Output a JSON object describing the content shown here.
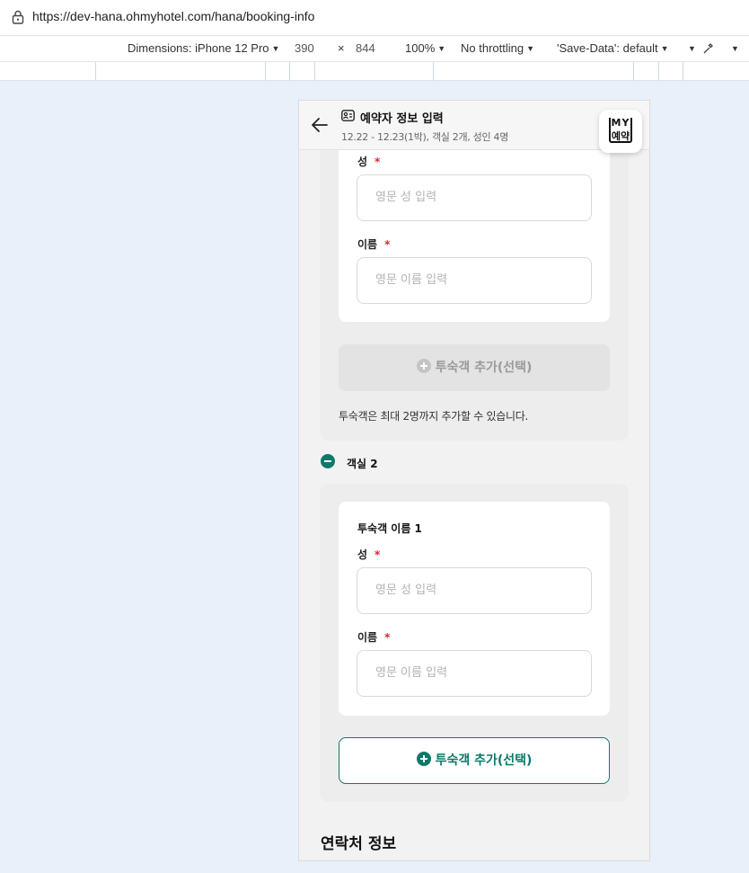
{
  "browser": {
    "url": "https://dev-hana.ohmyhotel.com/hana/booking-info"
  },
  "device_toolbar": {
    "dimensions_label": "Dimensions: iPhone 12 Pro",
    "width": "390",
    "times": "×",
    "height": "844",
    "zoom": "100%",
    "throttling": "No throttling",
    "save_data": "'Save-Data': default"
  },
  "header": {
    "title": "예약자 정보 입력",
    "subtitle": "12.22 - 12.23(1박), 객실 2개, 성인 4명",
    "my_label_top": "MY",
    "my_label_bottom": "예약"
  },
  "room1": {
    "last_name_label": "성",
    "last_name_placeholder": "영문 성 입력",
    "first_name_label": "이름",
    "first_name_placeholder": "영문 이름 입력",
    "add_guest_label": "투숙객 추가(선택)",
    "note": "투숙객은 최대 2명까지 추가할 수 있습니다."
  },
  "room2": {
    "title": "객실 2",
    "guest_title": "투숙객 이름 1",
    "last_name_label": "성",
    "last_name_placeholder": "영문 성 입력",
    "first_name_label": "이름",
    "first_name_placeholder": "영문 이름 입력",
    "add_guest_label": "투숙객 추가(선택)"
  },
  "contact": {
    "title": "연락처 정보"
  },
  "required_mark": "*",
  "colors": {
    "accent": "#0d7a68",
    "required": "#e0242d",
    "page_bg": "#e9f0f9"
  }
}
